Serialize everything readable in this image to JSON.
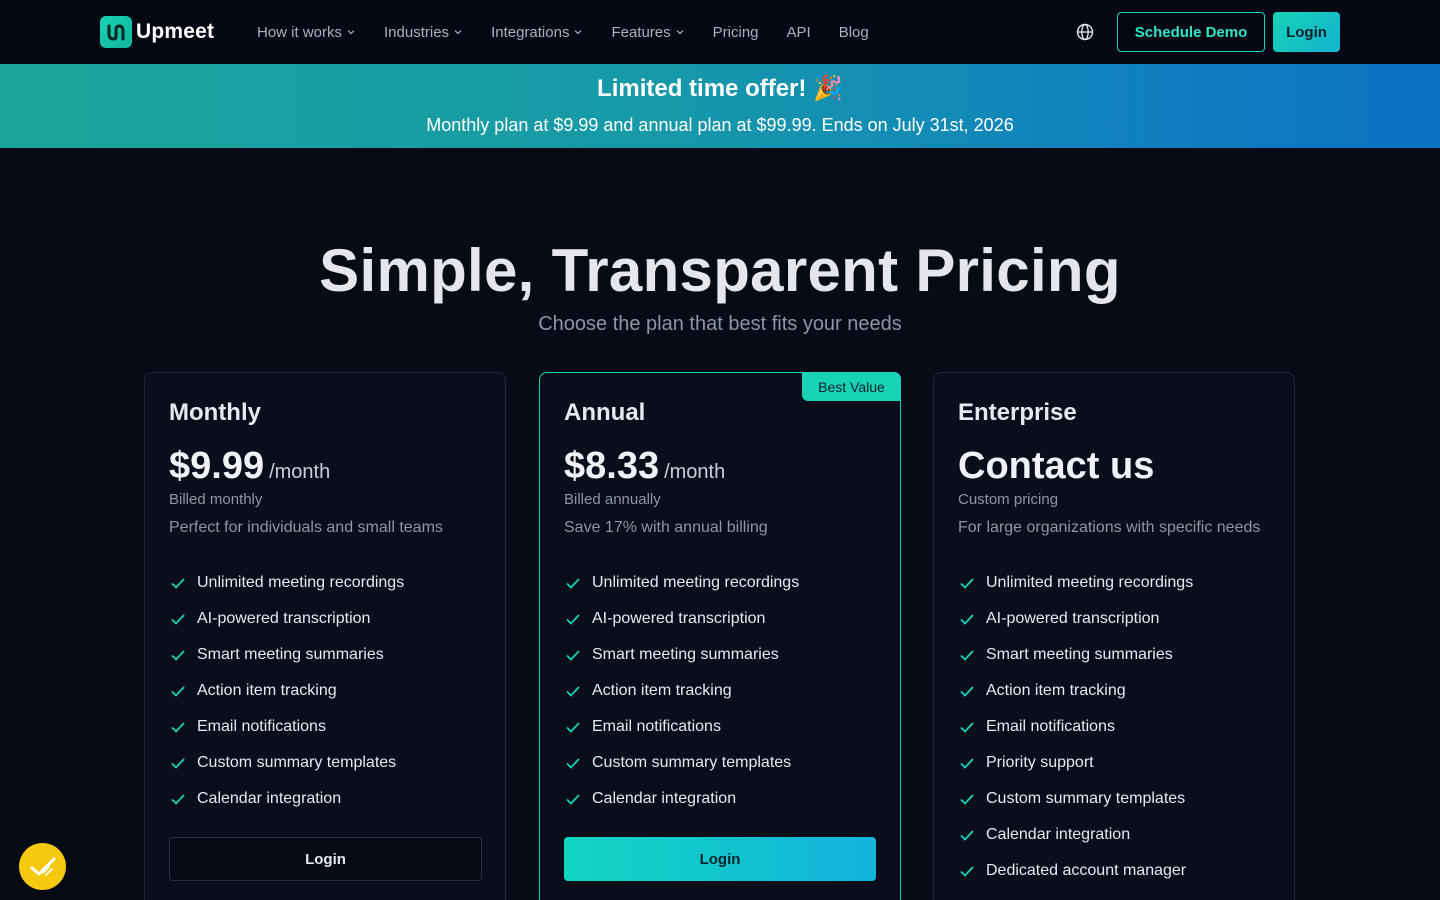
{
  "nav": {
    "brand": "Upmeet",
    "links": [
      {
        "label": "How it works",
        "dropdown": true
      },
      {
        "label": "Industries",
        "dropdown": true
      },
      {
        "label": "Integrations",
        "dropdown": true
      },
      {
        "label": "Features",
        "dropdown": true
      },
      {
        "label": "Pricing",
        "dropdown": false
      },
      {
        "label": "API",
        "dropdown": false
      },
      {
        "label": "Blog",
        "dropdown": false
      }
    ],
    "language_icon": "globe-icon",
    "schedule_demo_label": "Schedule Demo",
    "login_label": "Login"
  },
  "banner": {
    "title": "Limited time offer! 🎉",
    "subtitle": "Monthly plan at $9.99 and annual plan at $99.99. Ends on July 31st, 2026"
  },
  "hero": {
    "title": "Simple, Transparent Pricing",
    "subtitle": "Choose the plan that best fits your needs"
  },
  "plans": [
    {
      "name": "Monthly",
      "price": "$9.99",
      "period": "/month",
      "billing": "Billed monthly",
      "description": "Perfect for individuals and small teams",
      "features": [
        "Unlimited meeting recordings",
        "AI-powered transcription",
        "Smart meeting summaries",
        "Action item tracking",
        "Email notifications",
        "Custom summary templates",
        "Calendar integration"
      ],
      "button_label": "Login"
    },
    {
      "name": "Annual",
      "badge": "Best Value",
      "price": "$8.33",
      "period": "/month",
      "billing": "Billed annually",
      "description": "Save 17% with annual billing",
      "features": [
        "Unlimited meeting recordings",
        "AI-powered transcription",
        "Smart meeting summaries",
        "Action item tracking",
        "Email notifications",
        "Custom summary templates",
        "Calendar integration"
      ],
      "button_label": "Login"
    },
    {
      "name": "Enterprise",
      "price": "Contact us",
      "billing": "Custom pricing",
      "description": "For large organizations with specific needs",
      "features": [
        "Unlimited meeting recordings",
        "AI-powered transcription",
        "Smart meeting summaries",
        "Action item tracking",
        "Email notifications",
        "Priority support",
        "Custom summary templates",
        "Calendar integration",
        "Dedicated account manager"
      ]
    }
  ],
  "colors": {
    "accent": "#19d3b6",
    "background": "#070b16",
    "banner_start": "#1aa59a",
    "banner_end": "#0b72c4",
    "widget": "#f6c90e"
  }
}
